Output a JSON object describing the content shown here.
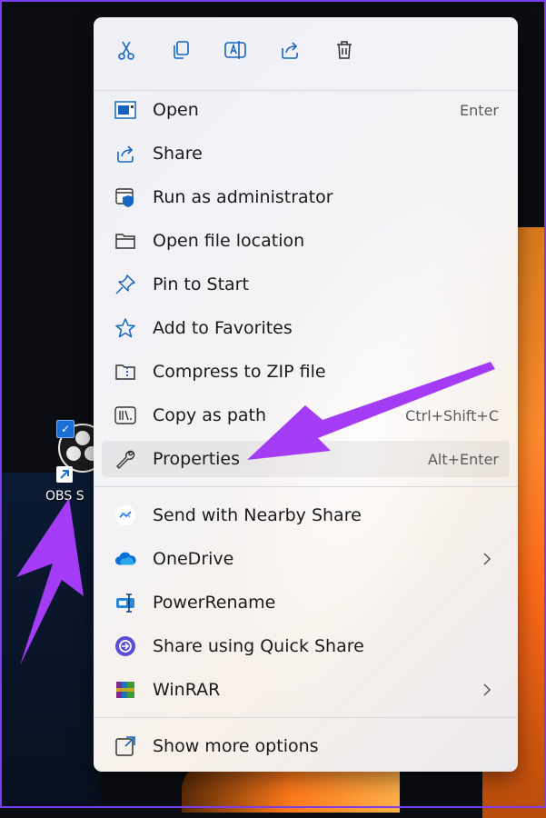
{
  "desktop": {
    "icon_label": "OBS S"
  },
  "menu": {
    "toolbar": [
      {
        "name": "cut-icon"
      },
      {
        "name": "copy-icon"
      },
      {
        "name": "rename-icon"
      },
      {
        "name": "share-icon"
      },
      {
        "name": "delete-icon"
      }
    ],
    "items": [
      {
        "label": "Open",
        "shortcut": "Enter",
        "icon": "open-window-icon"
      },
      {
        "label": "Share",
        "shortcut": "",
        "icon": "share-icon"
      },
      {
        "label": "Run as administrator",
        "shortcut": "",
        "icon": "shield-icon"
      },
      {
        "label": "Open file location",
        "shortcut": "",
        "icon": "folder-icon"
      },
      {
        "label": "Pin to Start",
        "shortcut": "",
        "icon": "pin-icon"
      },
      {
        "label": "Add to Favorites",
        "shortcut": "",
        "icon": "star-icon"
      },
      {
        "label": "Compress to ZIP file",
        "shortcut": "",
        "icon": "zip-folder-icon"
      },
      {
        "label": "Copy as path",
        "shortcut": "Ctrl+Shift+C",
        "icon": "copy-path-icon"
      },
      {
        "label": "Properties",
        "shortcut": "Alt+Enter",
        "icon": "wrench-icon"
      }
    ],
    "items2": [
      {
        "label": "Send with Nearby Share",
        "icon": "nearby-share-icon"
      },
      {
        "label": "OneDrive",
        "icon": "onedrive-icon",
        "submenu": true
      },
      {
        "label": "PowerRename",
        "icon": "powerrename-icon"
      },
      {
        "label": "Share using Quick Share",
        "icon": "quick-share-icon"
      },
      {
        "label": "WinRAR",
        "icon": "winrar-icon",
        "submenu": true
      }
    ],
    "more": {
      "label": "Show more options",
      "icon": "show-more-icon"
    }
  },
  "colors": {
    "accent": "#0067c0",
    "annotation_arrow": "#a33cf4"
  }
}
